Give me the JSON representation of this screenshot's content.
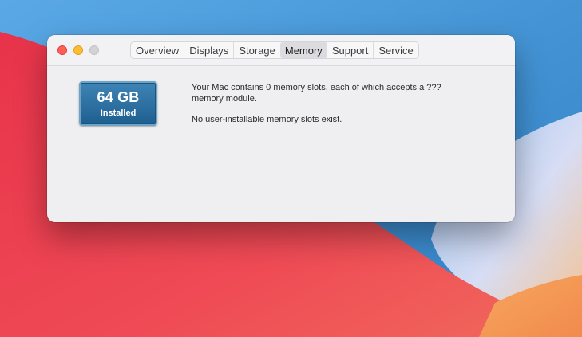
{
  "window": {
    "traffic_lights": [
      "close",
      "minimize",
      "zoom"
    ]
  },
  "tabs": [
    {
      "label": "Overview",
      "active": false
    },
    {
      "label": "Displays",
      "active": false
    },
    {
      "label": "Storage",
      "active": false
    },
    {
      "label": "Memory",
      "active": true
    },
    {
      "label": "Support",
      "active": false
    },
    {
      "label": "Service",
      "active": false
    }
  ],
  "memory": {
    "size": "64 GB",
    "caption": "Installed",
    "slots_text": "Your Mac contains 0 memory slots, each of which accepts a ??? memory module.",
    "note_text": "No user-installable memory slots exist."
  },
  "colors": {
    "close": "#fe5f57",
    "minimize": "#febc2e",
    "zoom_inactive": "#d3d3d5",
    "memory_badge": "#2a6c9c"
  }
}
